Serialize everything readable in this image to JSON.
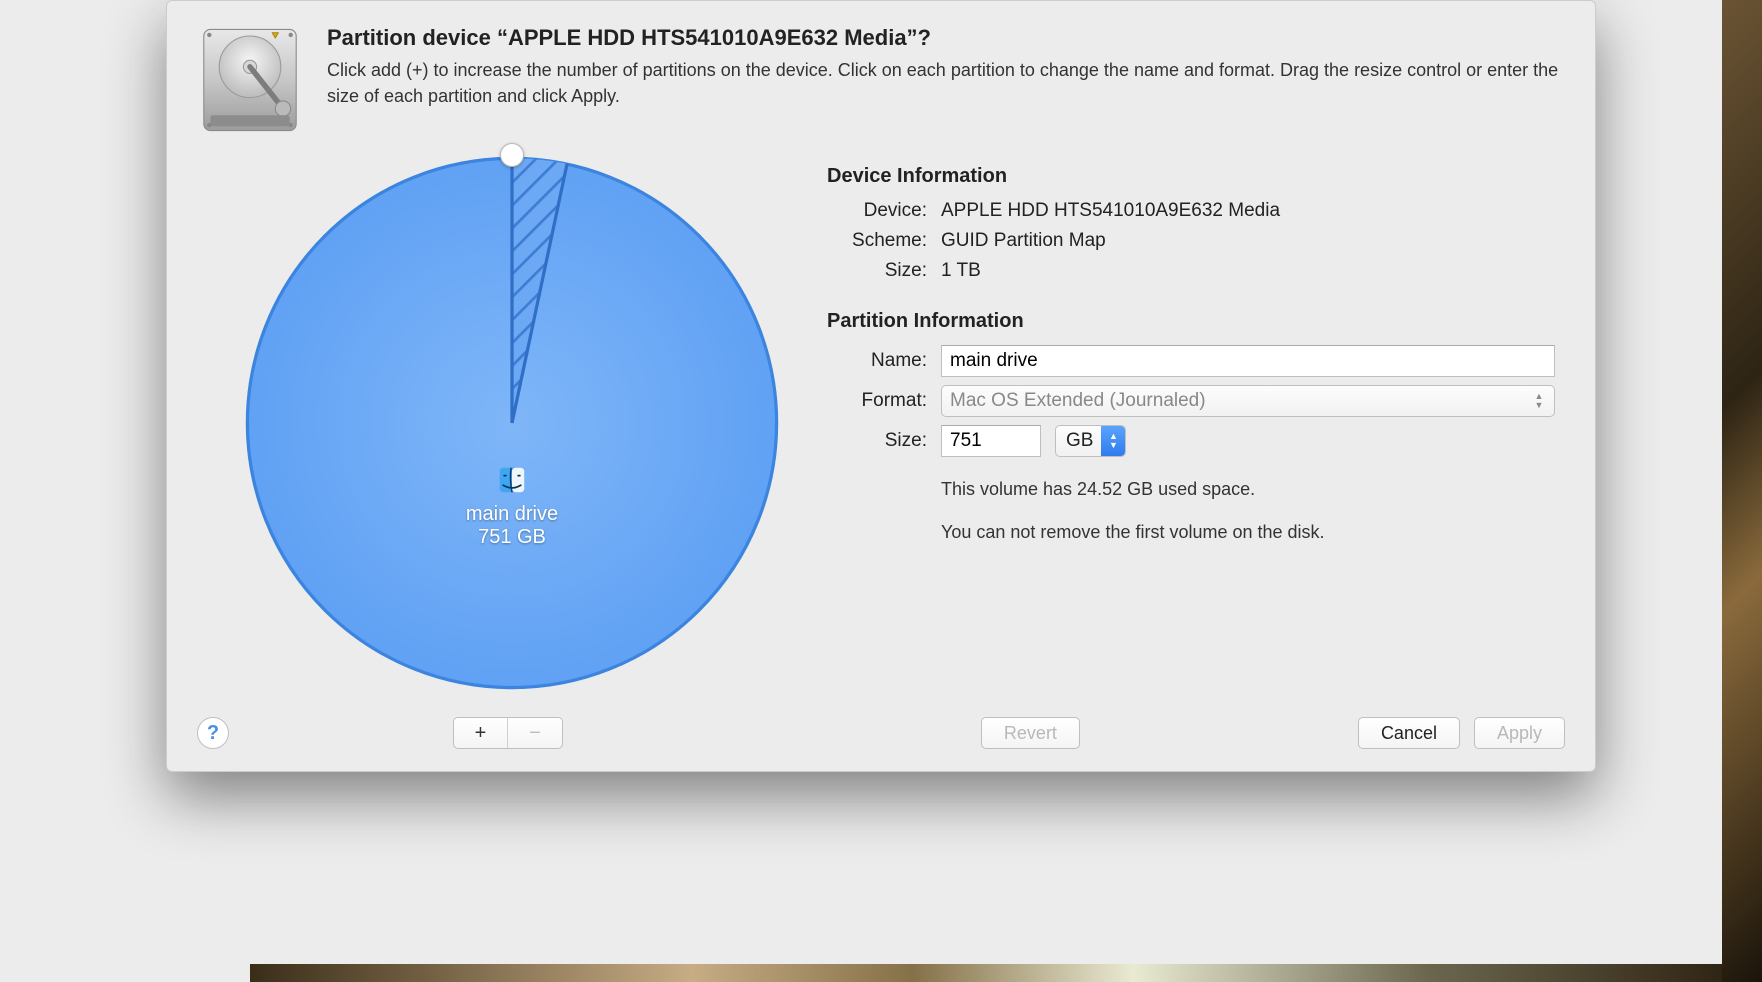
{
  "header": {
    "title": "Partition device “APPLE HDD HTS541010A9E632 Media”?",
    "subtitle": "Click add (+) to increase the number of partitions on the device. Click on each partition to change the name and format. Drag the resize control or enter the size of each partition and click Apply."
  },
  "pie": {
    "partition_name": "main drive",
    "partition_size": "751 GB"
  },
  "device_info": {
    "heading": "Device Information",
    "device_label": "Device:",
    "device_value": "APPLE HDD HTS541010A9E632 Media",
    "scheme_label": "Scheme:",
    "scheme_value": "GUID Partition Map",
    "size_label": "Size:",
    "size_value": "1 TB"
  },
  "partition_info": {
    "heading": "Partition Information",
    "name_label": "Name:",
    "name_value": "main drive",
    "format_label": "Format:",
    "format_value": "Mac OS Extended (Journaled)",
    "size_label": "Size:",
    "size_value": "751",
    "size_unit": "GB",
    "used_note": "This volume has 24.52 GB used space.",
    "remove_note": "You can not remove the first volume on the disk."
  },
  "footer": {
    "add_label": "+",
    "remove_label": "−",
    "revert": "Revert",
    "cancel": "Cancel",
    "apply": "Apply"
  },
  "chart_data": {
    "type": "pie",
    "title": "",
    "series": [
      {
        "name": "main drive",
        "value": 751,
        "unit": "GB"
      }
    ],
    "total": {
      "value": 1,
      "unit": "TB"
    },
    "used_hatched_fraction_estimate": 0.033
  }
}
